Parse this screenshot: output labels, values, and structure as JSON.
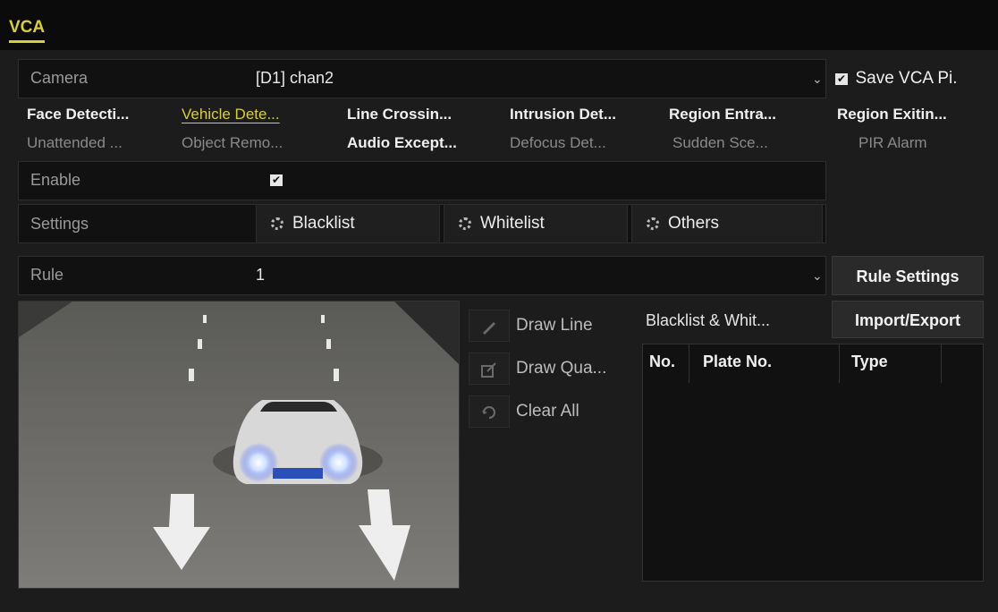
{
  "header": {
    "tab_label": "VCA"
  },
  "camera": {
    "label": "Camera",
    "value": "[D1] chan2",
    "save_label": "Save VCA Pi.",
    "save_checked": true
  },
  "vca_tabs": {
    "row1": [
      "Face Detecti...",
      "Vehicle Dete...",
      "Line Crossin...",
      "Intrusion Det...",
      "Region Entra...",
      "Region Exitin..."
    ],
    "row2": [
      "Unattended ...",
      "Object Remo...",
      "Audio Except...",
      "Defocus Det...",
      "Sudden Sce...",
      "PIR Alarm"
    ]
  },
  "enable": {
    "label": "Enable",
    "checked": true
  },
  "settings": {
    "label": "Settings",
    "blacklist": "Blacklist",
    "whitelist": "Whitelist",
    "others": "Others"
  },
  "rule": {
    "label": "Rule",
    "value": "1",
    "settings_button": "Rule Settings"
  },
  "tools": {
    "draw_line": "Draw Line",
    "draw_quad": "Draw Qua...",
    "clear_all": "Clear All"
  },
  "list": {
    "title": "Blacklist & Whit...",
    "import_export": "Import/Export",
    "columns": [
      "No.",
      "Plate No.",
      "Type"
    ],
    "rows": []
  },
  "colors": {
    "accent": "#d6cf3a",
    "background": "#1c1c1c",
    "field": "#111111"
  },
  "icons": {
    "checkbox": "checkbox-icon",
    "gear": "gear-icon",
    "dropdown": "chevron-down-icon",
    "pencil": "pencil-icon",
    "edit": "edit-icon",
    "clear": "clear-icon"
  }
}
